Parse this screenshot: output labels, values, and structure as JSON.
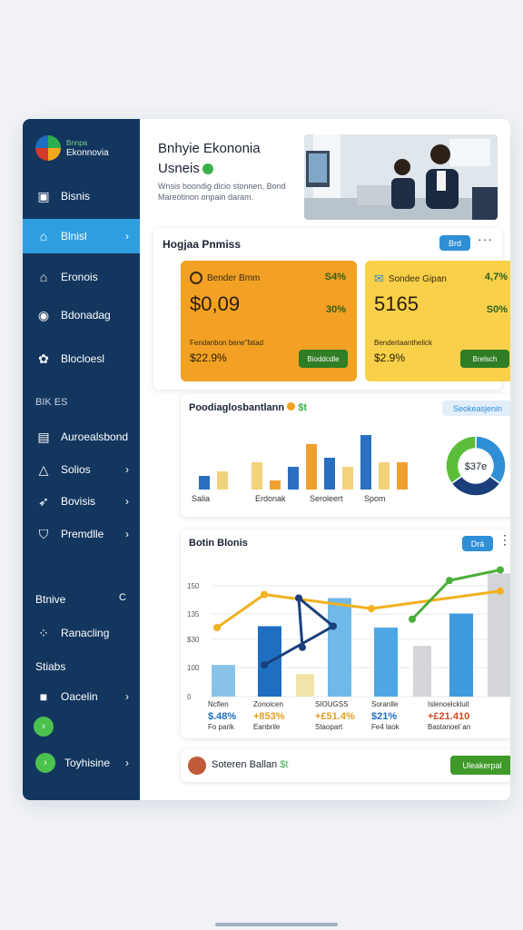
{
  "sidebar": {
    "brand_top": "Bnnpa",
    "brand_name": "Ekonnovia",
    "items": [
      {
        "label": "Bisnis",
        "icon": "card-icon"
      },
      {
        "label": "Blnisl",
        "icon": "home-icon"
      },
      {
        "label": "Eronois",
        "icon": "house-icon"
      },
      {
        "label": "Bdonadag",
        "icon": "target-icon"
      },
      {
        "label": "Blocloesl",
        "icon": "flower-icon"
      }
    ],
    "section1": "BIK ES",
    "items2": [
      {
        "label": "Auroealsbond",
        "icon": "building-icon"
      },
      {
        "label": "Solios",
        "icon": "warning-icon"
      },
      {
        "label": "Bovisis",
        "icon": "bird-icon"
      },
      {
        "label": "Premdlle",
        "icon": "shield-icon"
      }
    ],
    "section2": "Btnive",
    "section2_icon": "C",
    "item_ranacling": "Ranacling",
    "section3": "Stiabs",
    "item_oacelin": "Oacelin",
    "item_toyhsine": "Toyhisine"
  },
  "header": {
    "title_line1": "Bnhyie Ekononia",
    "title_line2": "Usneis",
    "description": "Wnsis boondig dicio stonnen, Bond Mareotinon onpain daram."
  },
  "summary": {
    "title": "Hogjaa Pnmiss",
    "pill": "Brd",
    "cards": [
      {
        "label": "Bender Bmm",
        "pct1": "S4%",
        "value": "$0,09",
        "pct2": "30%",
        "sub": "Fendanbon bene\"fatad",
        "sub_value": "$22.9%",
        "button": "Bioddcdle",
        "color": "#f2a124",
        "icon": "circle-icon"
      },
      {
        "label": "Sondee Gipan",
        "pct1": "4,7%",
        "value": "5165",
        "pct2": "S0%",
        "sub": "Bendertaanthelick",
        "sub_value": "$2.9%",
        "button": "Brelsch",
        "color": "#f9d04a",
        "icon": "check-icon"
      }
    ]
  },
  "chart_top_card": {
    "title": "Poodiaglosbantlann",
    "title_suffix": "$t",
    "pill": "Seokeasjenin",
    "donut_label": "$37e",
    "chart_data": {
      "type": "bar",
      "categories": [
        "Salia",
        "Erdonak",
        "Seroleert",
        "Spom"
      ],
      "series": [
        {
          "values": [
            3,
            6,
            10,
            12
          ]
        },
        {
          "values": [
            4,
            2,
            7,
            6
          ]
        },
        {
          "values": [
            0,
            5,
            5,
            6
          ]
        }
      ],
      "ylim": [
        0,
        14
      ]
    },
    "donut": {
      "type": "pie",
      "slices": [
        {
          "value": 35,
          "color": "#2f8fd6"
        },
        {
          "value": 30,
          "color": "#1a3f7a"
        },
        {
          "value": 35,
          "color": "#5bbe3a"
        }
      ]
    },
    "colors": {
      "blue": "#2a6fc0",
      "yellow": "#f2d27a",
      "orange": "#f0a030"
    }
  },
  "chart_bottom_card": {
    "title": "Botin Blonis",
    "pill": "Drá",
    "chart_data": {
      "type": "bar",
      "yticks": [
        "150",
        "135",
        "$30",
        "100",
        "0"
      ],
      "ylim": [
        0,
        160
      ],
      "bars": [
        45,
        100,
        32,
        140,
        98,
        72,
        118,
        175
      ],
      "bar_colors": [
        "#8ac3ea",
        "#1e6fc1",
        "#f2e3a8",
        "#6fb8e8",
        "#4ea6e4",
        "#d3d5d8",
        "#3f9bdd",
        "#d3d5d8"
      ],
      "line_blue": [
        45,
        100,
        140,
        70
      ],
      "line_green": [
        110,
        165,
        180
      ],
      "line_orange": [
        98,
        145,
        125,
        150
      ],
      "labels": [
        {
          "name": "Ncflen",
          "value": "$.48%",
          "sub": "Fo parik",
          "color": "#1e6fc1"
        },
        {
          "name": "Zonoicen",
          "value": "+853%",
          "sub": "Eanbrile",
          "color": "#e0a020"
        },
        {
          "name": "SIOUGSS",
          "value": "+£51.4%",
          "sub": "Staopart",
          "color": "#e0a020"
        },
        {
          "name": "Soranlle",
          "value": "$21%",
          "sub": "Fe4 laok",
          "color": "#1e6fc1"
        },
        {
          "name": "Islenoelckluit",
          "value": "+£21.410",
          "sub": "Bastanoel´an",
          "color": "#d24a20"
        }
      ]
    }
  },
  "footer_card": {
    "title": "Soteren Ballan",
    "suffix": "$t",
    "button": "Uleakerpal"
  }
}
